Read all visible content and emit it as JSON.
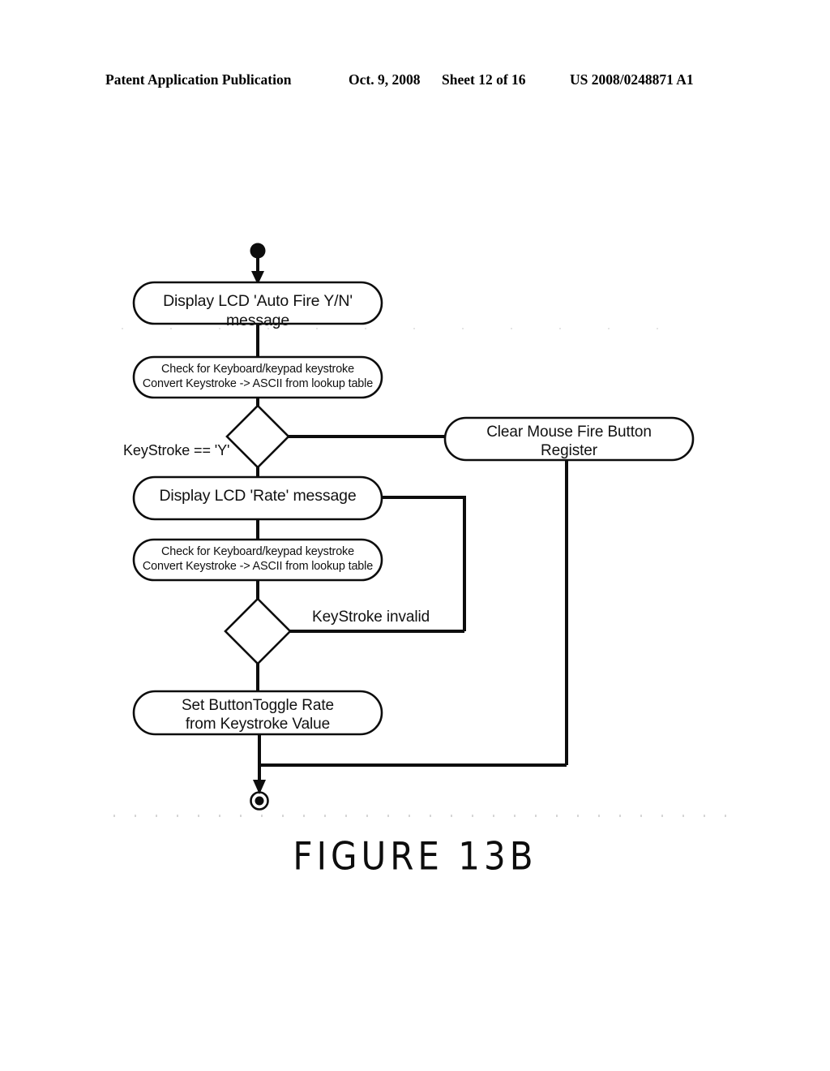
{
  "header": {
    "publication": "Patent Application Publication",
    "date": "Oct. 9, 2008",
    "sheet": "Sheet 12 of 16",
    "patent_number": "US 2008/0248871 A1"
  },
  "figure": {
    "caption": "FIGURE 13B"
  },
  "diagram": {
    "type": "uml-activity-flowchart",
    "start_node": "filled-start-dot",
    "end_node": "bullseye-end-node",
    "nodes": [
      {
        "id": "display-auto-fire",
        "shape": "rounded-rectangle",
        "text": "Display LCD 'Auto Fire Y/N' message"
      },
      {
        "id": "check-keystroke-1",
        "shape": "rounded-rectangle",
        "text": "Check for Keyboard/keypad keystroke\nConvert Keystroke -> ASCII from lookup table"
      },
      {
        "id": "decision-keystroke-y",
        "shape": "diamond",
        "text": ""
      },
      {
        "id": "clear-mouse-fire-register",
        "shape": "rounded-rectangle",
        "text": "Clear Mouse Fire Button\nRegister"
      },
      {
        "id": "display-rate",
        "shape": "rounded-rectangle",
        "text": "Display LCD 'Rate' message"
      },
      {
        "id": "check-keystroke-2",
        "shape": "rounded-rectangle",
        "text": "Check for Keyboard/keypad keystroke\nConvert Keystroke -> ASCII from lookup table"
      },
      {
        "id": "decision-keystroke-valid",
        "shape": "diamond",
        "text": ""
      },
      {
        "id": "set-button-toggle-rate",
        "shape": "rounded-rectangle",
        "text": "Set ButtonToggle Rate\nfrom Keystroke Value"
      }
    ],
    "edge_labels": [
      {
        "id": "guard-keystroke-y",
        "text": "KeyStroke == 'Y'"
      },
      {
        "id": "guard-keystroke-invalid",
        "text": "KeyStroke invalid"
      }
    ]
  },
  "colors": {
    "ink": "#0d0d0d",
    "paper": "#ffffff"
  }
}
